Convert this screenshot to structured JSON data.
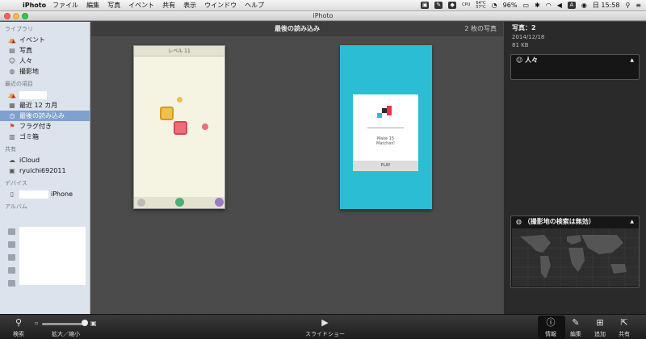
{
  "menubar": {
    "app_name": "iPhoto",
    "items": [
      "ファイル",
      "編集",
      "写真",
      "イベント",
      "共有",
      "表示",
      "ウインドウ",
      "ヘルプ"
    ],
    "cpu_label": "CPU",
    "cpu_temp": "64°C",
    "temp2": "57°C",
    "battery": "96%",
    "input_mode": "A",
    "clock": "日 15:58"
  },
  "window": {
    "title": "iPhoto"
  },
  "sidebar": {
    "library_header": "ライブラリ",
    "library_items": [
      {
        "label": "イベント",
        "icon": "events-icon"
      },
      {
        "label": "写真",
        "icon": "photos-icon"
      },
      {
        "label": "人々",
        "icon": "people-icon"
      },
      {
        "label": "撮影地",
        "icon": "places-icon"
      }
    ],
    "recent_header": "最近の項目",
    "recent_items": [
      {
        "label": "最近 12 カ月",
        "icon": "calendar-icon"
      },
      {
        "label": "最後の読み込み",
        "icon": "last-import-icon"
      },
      {
        "label": "フラグ付き",
        "icon": "flag-icon"
      },
      {
        "label": "ゴミ箱",
        "icon": "trash-icon"
      }
    ],
    "shared_header": "共有",
    "shared_items": [
      {
        "label": "iCloud",
        "icon": "icloud-icon"
      },
      {
        "label": "ryuichi692011",
        "icon": "shared-stream-icon"
      }
    ],
    "devices_header": "デバイス",
    "device_label": "iPhone",
    "albums_header": "アルバム"
  },
  "main": {
    "title": "最後の読み込み",
    "photo_count": "2 枚の写真",
    "photo1": {
      "level_label": "レベル 11"
    },
    "photo2": {
      "line1": "Make 15",
      "line2": "Matches!",
      "play": "PLAY"
    }
  },
  "info": {
    "photo_count": "写真：2",
    "date": "2014/12/18",
    "size": "81 KB",
    "people_label": "人々",
    "places_label": "（撮影地の検索は無効）"
  },
  "toolbar": {
    "search": "検索",
    "zoom": "拡大／縮小",
    "slideshow": "スライドショー",
    "info": "情報",
    "edit": "編集",
    "add": "追加",
    "share": "共有"
  }
}
